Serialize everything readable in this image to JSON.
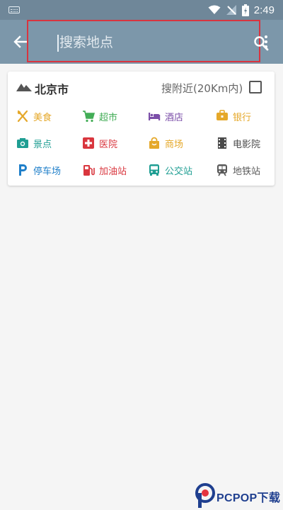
{
  "status_bar": {
    "time": "2:49"
  },
  "app_bar": {
    "search_placeholder": "搜索地点"
  },
  "card": {
    "city": "北京市",
    "nearby_label": "搜附近(20Km内)",
    "categories": [
      {
        "label": "美食",
        "icon": "fork-knife-icon",
        "color": "#e5a82a"
      },
      {
        "label": "超市",
        "icon": "cart-icon",
        "color": "#43ad57"
      },
      {
        "label": "酒店",
        "icon": "bed-icon",
        "color": "#7b4ea8"
      },
      {
        "label": "银行",
        "icon": "bank-icon",
        "color": "#e5a82a"
      },
      {
        "label": "景点",
        "icon": "camera-icon",
        "color": "#1f9e93"
      },
      {
        "label": "医院",
        "icon": "hospital-icon",
        "color": "#d9363e"
      },
      {
        "label": "商场",
        "icon": "shopping-bag-icon",
        "color": "#e5a82a"
      },
      {
        "label": "电影院",
        "icon": "film-icon",
        "color": "#4a4a4a"
      },
      {
        "label": "停车场",
        "icon": "parking-icon",
        "color": "#1f7fc9"
      },
      {
        "label": "加油站",
        "icon": "gas-station-icon",
        "color": "#d9363e"
      },
      {
        "label": "公交站",
        "icon": "bus-icon",
        "color": "#1f9e93"
      },
      {
        "label": "地铁站",
        "icon": "subway-icon",
        "color": "#5a5a5a"
      }
    ]
  },
  "watermark": {
    "text": "PCPOP下载"
  }
}
